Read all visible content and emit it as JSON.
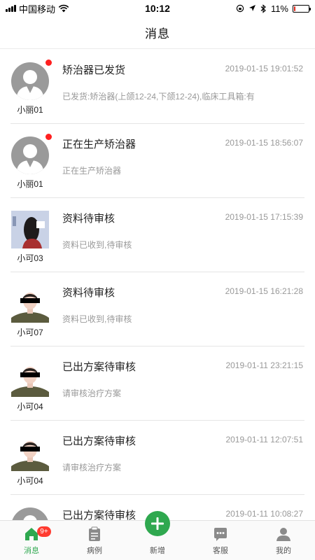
{
  "status_bar": {
    "carrier": "中国移动",
    "time": "10:12",
    "battery_text": "11%",
    "battery_level": 0.11
  },
  "header": {
    "title": "消息"
  },
  "messages": [
    {
      "avatar": "default",
      "name": "小丽01",
      "title": "矫治器已发货",
      "time": "2019-01-15 19:01:52",
      "preview": "已发货:矫治器(上颌12-24,下颌12-24),临床工具箱:有",
      "unread": true
    },
    {
      "avatar": "default",
      "name": "小丽01",
      "title": "正在生产矫治器",
      "time": "2019-01-15 18:56:07",
      "preview": "正在生产矫治器",
      "unread": true
    },
    {
      "avatar": "photo-side",
      "name": "小可03",
      "title": "资料待审核",
      "time": "2019-01-15 17:15:39",
      "preview": "资料已收到,待审核",
      "unread": false
    },
    {
      "avatar": "photo-front",
      "name": "小可07",
      "title": "资料待审核",
      "time": "2019-01-15 16:21:28",
      "preview": "资料已收到,待审核",
      "unread": false
    },
    {
      "avatar": "photo-front",
      "name": "小可04",
      "title": "已出方案待审核",
      "time": "2019-01-11 23:21:15",
      "preview": "请审核治疗方案",
      "unread": false
    },
    {
      "avatar": "photo-front",
      "name": "小可04",
      "title": "已出方案待审核",
      "time": "2019-01-11 12:07:51",
      "preview": "请审核治疗方案",
      "unread": false
    },
    {
      "avatar": "default",
      "name": "",
      "title": "已出方案待审核",
      "time": "2019-01-11 10:08:27",
      "preview": "",
      "unread": false
    }
  ],
  "tab_bar": {
    "tabs": [
      {
        "key": "messages",
        "label": "消息",
        "icon": "home-icon",
        "active": true,
        "badge": "9+"
      },
      {
        "key": "cases",
        "label": "病例",
        "icon": "clipboard-icon",
        "active": false,
        "badge": ""
      },
      {
        "key": "add",
        "label": "新增",
        "icon": "plus-icon",
        "active": false,
        "badge": ""
      },
      {
        "key": "service",
        "label": "客服",
        "icon": "chat-icon",
        "active": false,
        "badge": ""
      },
      {
        "key": "mine",
        "label": "我的",
        "icon": "user-icon",
        "active": false,
        "badge": ""
      }
    ]
  },
  "colors": {
    "accent": "#2fa84f",
    "unread_dot": "#ff2020",
    "badge": "#ff3b30",
    "battery_low": "#e0271a"
  }
}
